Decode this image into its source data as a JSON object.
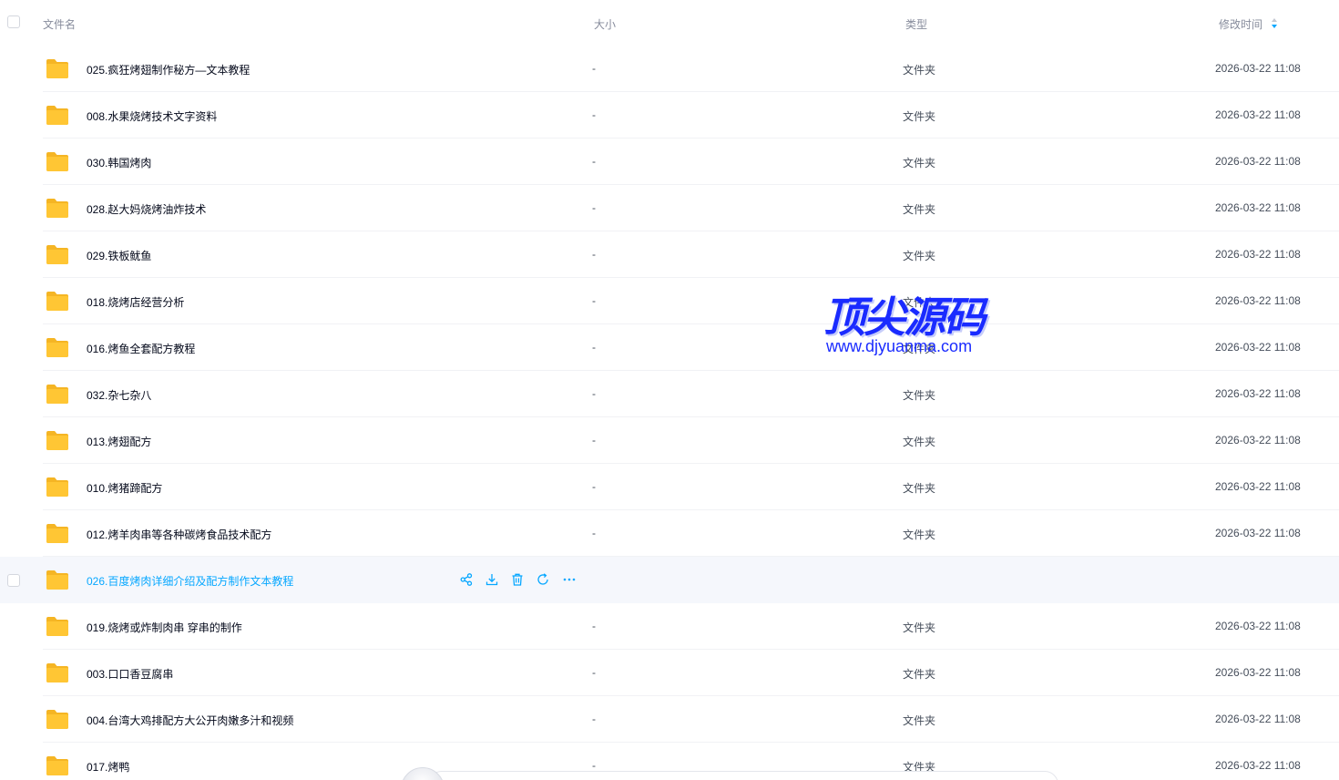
{
  "header": {
    "name": "文件名",
    "size": "大小",
    "type": "类型",
    "time": "修改时间"
  },
  "colors": {
    "accent": "#06a7ff",
    "folder": "#ffc634",
    "text": "#03081a",
    "muted": "#878c9c"
  },
  "rows": [
    {
      "name": "025.疯狂烤翅制作秘方—文本教程",
      "size": "-",
      "type": "文件夹",
      "time": "2026-03-22 11:08"
    },
    {
      "name": "008.水果烧烤技术文字资料",
      "size": "-",
      "type": "文件夹",
      "time": "2026-03-22 11:08"
    },
    {
      "name": "030.韩国烤肉",
      "size": "-",
      "type": "文件夹",
      "time": "2026-03-22 11:08"
    },
    {
      "name": "028.赵大妈烧烤油炸技术",
      "size": "-",
      "type": "文件夹",
      "time": "2026-03-22 11:08"
    },
    {
      "name": "029.铁板鱿鱼",
      "size": "-",
      "type": "文件夹",
      "time": "2026-03-22 11:08"
    },
    {
      "name": "018.烧烤店经营分析",
      "size": "-",
      "type": "文件夹",
      "time": "2026-03-22 11:08"
    },
    {
      "name": "016.烤鱼全套配方教程",
      "size": "-",
      "type": "文件夹",
      "time": "2026-03-22 11:08"
    },
    {
      "name": "032.杂七杂八",
      "size": "-",
      "type": "文件夹",
      "time": "2026-03-22 11:08"
    },
    {
      "name": "013.烤翅配方",
      "size": "-",
      "type": "文件夹",
      "time": "2026-03-22 11:08"
    },
    {
      "name": "010.烤猪蹄配方",
      "size": "-",
      "type": "文件夹",
      "time": "2026-03-22 11:08"
    },
    {
      "name": "012.烤羊肉串等各种碳烤食品技术配方",
      "size": "-",
      "type": "文件夹",
      "time": "2026-03-22 11:08"
    },
    {
      "name": "026.百度烤肉详细介绍及配方制作文本教程",
      "size": "",
      "type": "",
      "time": "",
      "hover": true
    },
    {
      "name": "019.烧烤或炸制肉串 穿串的制作",
      "size": "-",
      "type": "文件夹",
      "time": "2026-03-22 11:08"
    },
    {
      "name": "003.口口香豆腐串",
      "size": "-",
      "type": "文件夹",
      "time": "2026-03-22 11:08"
    },
    {
      "name": "004.台湾大鸡排配方大公开肉嫩多汁和视频",
      "size": "-",
      "type": "文件夹",
      "time": "2026-03-22 11:08"
    },
    {
      "name": "017.烤鸭",
      "size": "-",
      "type": "文件夹",
      "time": "2026-03-22 11:08"
    }
  ],
  "hover_actions": [
    "share-icon",
    "download-icon",
    "delete-icon",
    "refresh-icon",
    "more-icon"
  ],
  "watermark": {
    "title": "顶尖源码",
    "url": "www.djyuanma.com"
  }
}
